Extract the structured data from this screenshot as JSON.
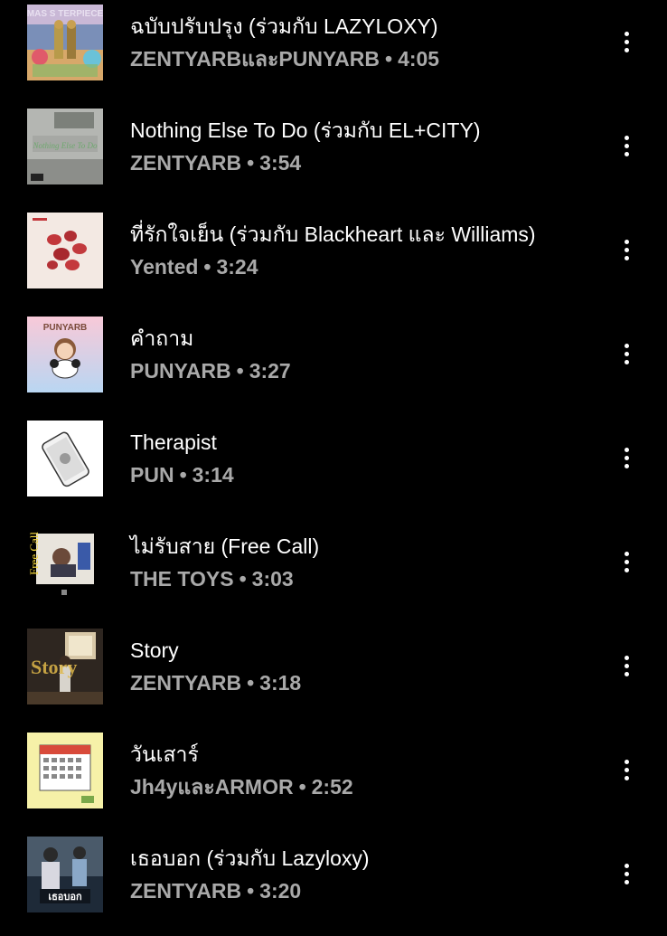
{
  "tracks": [
    {
      "title": "ฉบับปรับปรุง (ร่วมกับ LAZYLOXY)",
      "artist": "ZENTYARBและPUNYARB",
      "duration": "4:05",
      "thumb_text": "MAS S TERPIECE"
    },
    {
      "title": "Nothing Else To Do (ร่วมกับ EL+CITY)",
      "artist": "ZENTYARB",
      "duration": "3:54",
      "thumb_text": "Nothing Else To Do"
    },
    {
      "title": "ที่รักใจเย็น (ร่วมกับ Blackheart และ Williams)",
      "artist": "Yented",
      "duration": "3:24",
      "thumb_text": ""
    },
    {
      "title": "คำถาม",
      "artist": "PUNYARB",
      "duration": "3:27",
      "thumb_text": "PUNYARB"
    },
    {
      "title": "Therapist",
      "artist": "PUN",
      "duration": "3:14",
      "thumb_text": ""
    },
    {
      "title": "ไม่รับสาย (Free Call)",
      "artist": "THE TOYS",
      "duration": "3:03",
      "thumb_text": "Free Call"
    },
    {
      "title": "Story",
      "artist": "ZENTYARB",
      "duration": "3:18",
      "thumb_text": "Story"
    },
    {
      "title": "วันเสาร์",
      "artist": "Jh4yและARMOR",
      "duration": "2:52",
      "thumb_text": ""
    },
    {
      "title": "เธอบอก (ร่วมกับ Lazyloxy)",
      "artist": "ZENTYARB",
      "duration": "3:20",
      "thumb_text": "เธอบอก"
    }
  ],
  "separator": "•",
  "more_icon": "more-vert-icon",
  "colors": {
    "background": "#000000",
    "title": "#ffffff",
    "subtitle": "#a9a9a9"
  }
}
